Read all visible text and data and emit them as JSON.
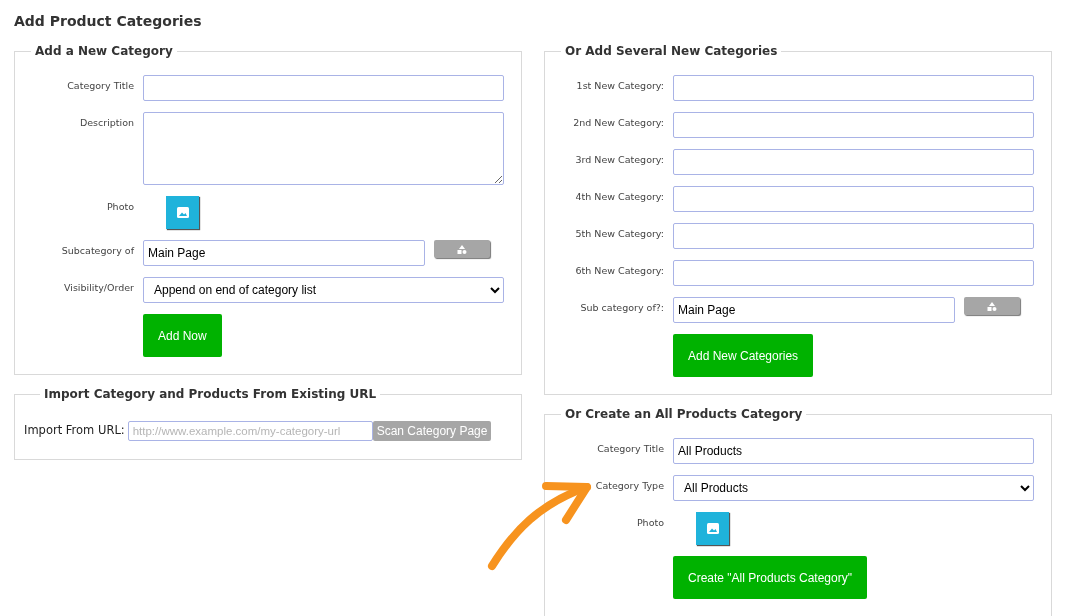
{
  "page_title": "Add Product Categories",
  "new_category": {
    "legend": "Add a New Category",
    "fields": [
      {
        "kind": "text",
        "label": "Category Title"
      },
      {
        "kind": "textarea",
        "label": "Description"
      },
      {
        "kind": "photo",
        "label": "Photo"
      },
      {
        "kind": "picker",
        "label": "Subcategory of",
        "value": "Main Page"
      },
      {
        "kind": "select",
        "label": "Visibility/Order",
        "value": "Append on end of category list"
      }
    ],
    "submit": "Add Now"
  },
  "import": {
    "legend": "Import Category and Products From Existing URL",
    "label": "Import From URL:",
    "placeholder": "http://www.example.com/my-category-url",
    "button": "Scan Category Page"
  },
  "several": {
    "legend": "Or Add Several New Categories",
    "fields": [
      {
        "kind": "text",
        "label": "1st New Category:"
      },
      {
        "kind": "text",
        "label": "2nd New Category:"
      },
      {
        "kind": "text",
        "label": "3rd New Category:"
      },
      {
        "kind": "text",
        "label": "4th New Category:"
      },
      {
        "kind": "text",
        "label": "5th New Category:"
      },
      {
        "kind": "text",
        "label": "6th New Category:"
      },
      {
        "kind": "picker",
        "label": "Sub category of?:",
        "value": "Main Page"
      }
    ],
    "submit": "Add New Categories"
  },
  "all_products": {
    "legend": "Or Create an All Products Category",
    "fields": [
      {
        "kind": "text",
        "label": "Category Title",
        "value": "All Products"
      },
      {
        "kind": "select",
        "label": "Category Type",
        "value": "All Products"
      },
      {
        "kind": "photo",
        "label": "Photo"
      }
    ],
    "submit": "Create \"All Products Category\""
  }
}
